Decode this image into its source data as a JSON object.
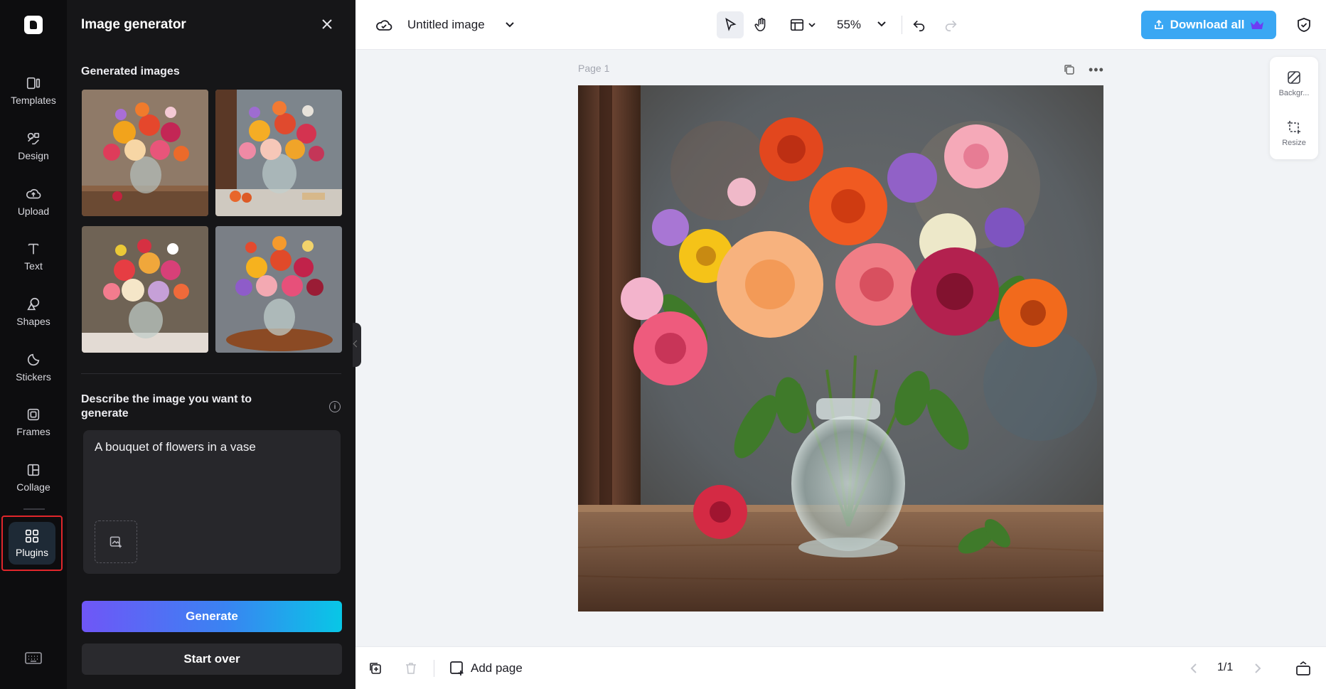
{
  "sidebar": {
    "items": [
      {
        "label": "Templates",
        "icon": "templates-icon"
      },
      {
        "label": "Design",
        "icon": "design-icon"
      },
      {
        "label": "Upload",
        "icon": "upload-icon"
      },
      {
        "label": "Text",
        "icon": "text-icon"
      },
      {
        "label": "Shapes",
        "icon": "shapes-icon"
      },
      {
        "label": "Stickers",
        "icon": "stickers-icon"
      },
      {
        "label": "Frames",
        "icon": "frames-icon"
      },
      {
        "label": "Collage",
        "icon": "collage-icon"
      }
    ],
    "active": {
      "label": "Plugins",
      "icon": "plugins-icon",
      "highlight_color": "#e0262b"
    }
  },
  "panel": {
    "title": "Image generator",
    "generated_title": "Generated images",
    "describe_label": "Describe the image you want to generate",
    "prompt_value": "A bouquet of flowers in a vase",
    "generate_label": "Generate",
    "startover_label": "Start over"
  },
  "topbar": {
    "doc_title": "Untitled image",
    "zoom": "55%",
    "download_label": "Download all",
    "download_color": "#3aa7f3"
  },
  "canvas": {
    "page_label": "Page 1"
  },
  "right_tools": [
    {
      "label": "Backgr...",
      "icon": "background-icon"
    },
    {
      "label": "Resize",
      "icon": "resize-icon"
    }
  ],
  "bottombar": {
    "add_page_label": "Add page",
    "pager": "1/1"
  }
}
